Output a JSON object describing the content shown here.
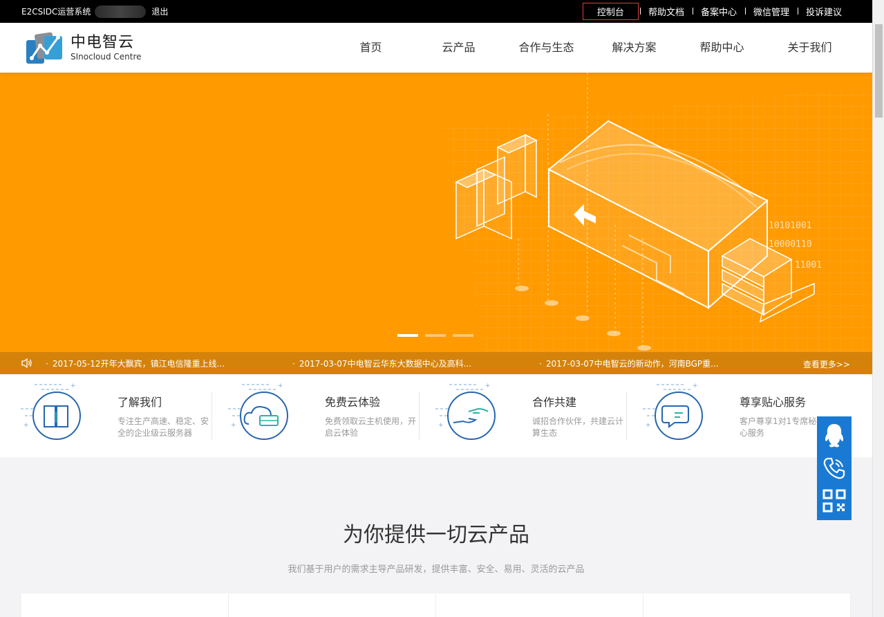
{
  "topbar": {
    "system_name": "E2CSIDC运营系统",
    "logout": "退出",
    "links": [
      "控制台",
      "帮助文档",
      "备案中心",
      "微信管理",
      "投诉建议"
    ]
  },
  "header": {
    "logo_cn": "中电智云",
    "logo_en": "SInocloud Centre",
    "nav": [
      "首页",
      "云产品",
      "合作与生态",
      "解决方案",
      "帮助中心",
      "关于我们"
    ]
  },
  "banner": {
    "slides_total": 3,
    "active_slide": 1,
    "binary_text": [
      "10101001",
      "10000110",
      "11001"
    ]
  },
  "notice": {
    "items": [
      "2017-05-12开年大飘宾，镇江电信隆重上线...",
      "2017-03-07中电智云华东大数据中心及高科...",
      "2017-03-07中电智云的新动作，河南BGP重..."
    ],
    "more": "查看更多>>"
  },
  "features": [
    {
      "title": "了解我们",
      "desc": "专注生产高速、稳定、安全的企业级云服务器",
      "icon": "book-icon"
    },
    {
      "title": "免费云体验",
      "desc": "免费领取云主机使用，开启云体验",
      "icon": "cloud-server-icon"
    },
    {
      "title": "合作共建",
      "desc": "诚招合作伙伴，共建云计算生态",
      "icon": "handshake-icon"
    },
    {
      "title": "尊享贴心服务",
      "desc": "客户尊享1对1专席秘书贴心服务",
      "icon": "chat-icon"
    }
  ],
  "products": {
    "title": "为你提供一切云产品",
    "subtitle": "我们基于用户的需求主导产品研发，提供丰富、安全、易用、灵活的云产品"
  },
  "float_panel": [
    "qq-icon",
    "phone-icon",
    "qrcode-icon"
  ],
  "colors": {
    "banner": "#ff9a00",
    "notice": "#d4820a",
    "accent_blue": "#1a7ad3",
    "active_border": "#e63b3b"
  }
}
